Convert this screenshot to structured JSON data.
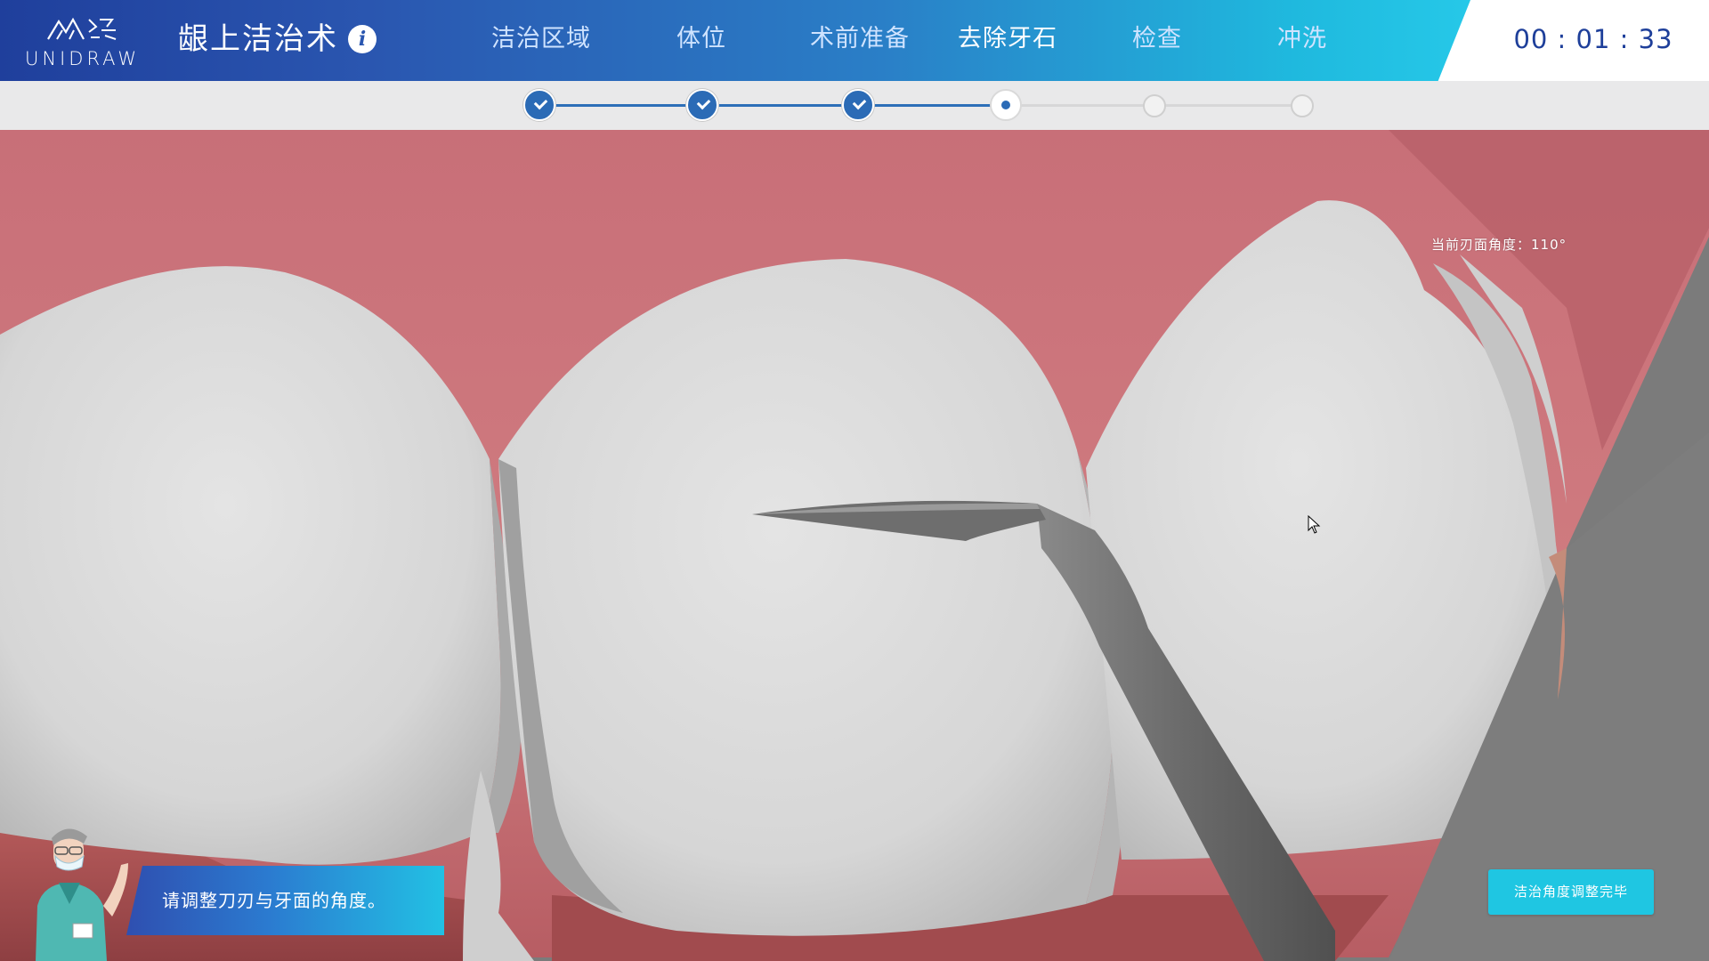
{
  "header": {
    "logo_text": "UNIDRAW",
    "logo_mark_text": "众绘",
    "title": "龈上洁治术",
    "info_icon": "info-icon",
    "tabs": [
      {
        "label": "洁治区域",
        "state": "done"
      },
      {
        "label": "体位",
        "state": "done"
      },
      {
        "label": "术前准备",
        "state": "done"
      },
      {
        "label": "去除牙石",
        "state": "current"
      },
      {
        "label": "检查",
        "state": "todo"
      },
      {
        "label": "冲洗",
        "state": "todo"
      }
    ],
    "timer": "00 : 01 : 33"
  },
  "progress": {
    "steps": [
      "done",
      "done",
      "done",
      "current",
      "todo",
      "todo"
    ]
  },
  "viewport": {
    "angle_readout": "当前刃面角度：110°"
  },
  "assistant": {
    "avatar": "doctor-avatar",
    "instruction": "请调整刀刃与牙面的角度。"
  },
  "actions": {
    "confirm_label": "洁治角度调整完毕"
  },
  "colors": {
    "header_gradient_start": "#1f3f9c",
    "header_gradient_end": "#26c8e8",
    "progress_done": "#2b6bb6",
    "confirm_button": "#1fc6e2",
    "gum": "#c96f74",
    "tooth": "#dcdcdc"
  }
}
